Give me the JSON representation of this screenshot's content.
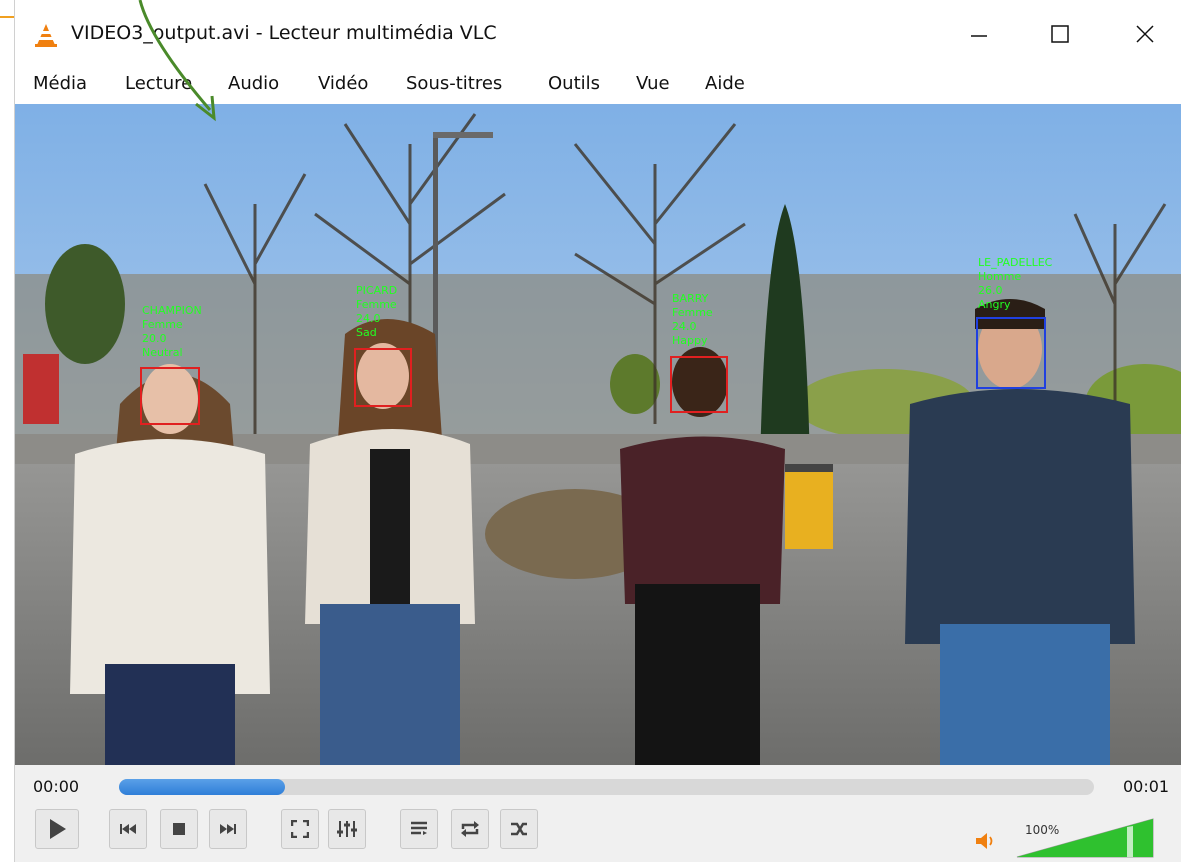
{
  "window": {
    "title": "VIDEO3_output.avi - Lecteur multimédia VLC"
  },
  "menu": [
    {
      "label": "Média"
    },
    {
      "label": "Lecture"
    },
    {
      "label": "Audio"
    },
    {
      "label": "Vidéo"
    },
    {
      "label": "Sous-titres"
    },
    {
      "label": "Outils"
    },
    {
      "label": "Vue"
    },
    {
      "label": "Aide"
    }
  ],
  "detections": [
    {
      "name": "CHAMPION",
      "gender": "Femme",
      "age": "20.0",
      "emotion": "Neutral",
      "box_color": "#e02020"
    },
    {
      "name": "PICARD",
      "gender": "Femme",
      "age": "24.0",
      "emotion": "Sad",
      "box_color": "#e02020"
    },
    {
      "name": "BARRY",
      "gender": "Femme",
      "age": "24.0",
      "emotion": "Happy",
      "box_color": "#e02020"
    },
    {
      "name": "LE_PADELLEC",
      "gender": "Homme",
      "age": "26.0",
      "emotion": "Angry",
      "box_color": "#2040e0"
    }
  ],
  "playback": {
    "current_time": "00:00",
    "total_time": "00:01",
    "progress_fraction": 0.17
  },
  "volume": {
    "label": "100%",
    "level_fraction": 1.0
  },
  "colors": {
    "accent": "#2f7ed8",
    "label_text": "#22ff22",
    "volume_green": "#2fc12f",
    "vlc_orange": "#f08010"
  },
  "icons": {
    "app": "vlc-cone-icon",
    "minimize": "minimize-icon",
    "maximize": "maximize-icon",
    "close": "close-icon",
    "play": "play-icon",
    "previous": "previous-icon",
    "stop": "stop-icon",
    "next": "next-icon",
    "fullscreen": "fullscreen-icon",
    "extended": "extended-settings-icon",
    "playlist": "playlist-icon",
    "loop": "loop-icon",
    "random": "random-icon",
    "volume": "speaker-icon"
  }
}
